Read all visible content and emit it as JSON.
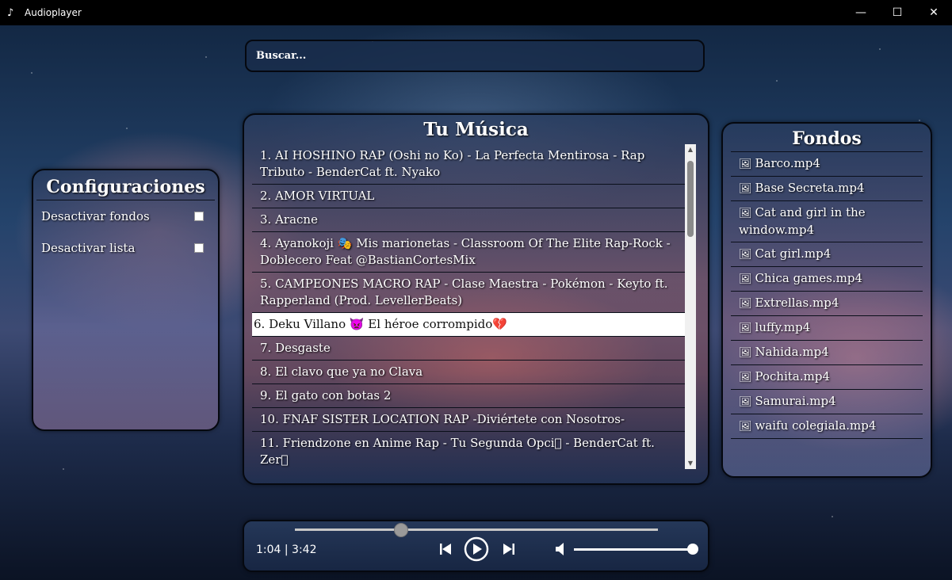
{
  "window": {
    "title": "Audioplayer",
    "minimize_icon": "—",
    "maximize_icon": "☐",
    "close_icon": "✕"
  },
  "search": {
    "placeholder": "Buscar..."
  },
  "config": {
    "title": "Configuraciones",
    "options": [
      {
        "label": "Desactivar fondos",
        "checked": false
      },
      {
        "label": "Desactivar lista",
        "checked": false
      }
    ]
  },
  "music": {
    "title": "Tu Música",
    "selected_index": 5,
    "songs": [
      "1. AI HOSHINO RAP (Oshi no Ko) - La Perfecta Mentirosa - Rap Tributo - BenderCat ft. Nyako",
      "2. AMOR VIRTUAL",
      "3. Aracne",
      "4. Ayanokoji 🎭 Mis marionetas - Classroom Of The Elite Rap-Rock - Doblecero Feat @BastianCortesMix",
      "5. CAMPEONES MACRO RAP - Clase Maestra - Pokémon - Keyto ft. Rapperland (Prod. LevellerBeats)",
      "6. Deku Villano 👿 El héroe corrompido💔",
      "7. Desgaste",
      "8. El clavo que ya no Clava",
      "9. El gato con botas 2",
      "10. FNAF SISTER LOCATION RAP -Diviértete con Nosotros-",
      "11. Friendzone en Anime Rap - Tu Segunda Opci\u0000 - BenderCat ft. Zer\u0000"
    ]
  },
  "fondos": {
    "title": "Fondos",
    "items": [
      "Barco.mp4",
      "Base Secreta.mp4",
      "Cat and girl in the window.mp4",
      "Cat girl.mp4",
      "Chica games.mp4",
      "Extrellas.mp4",
      "luffy.mp4",
      "Nahida.mp4",
      "Pochita.mp4",
      "Samurai.mp4",
      "waifu colegiala.mp4"
    ]
  },
  "player": {
    "time": "1:04 | 3:42",
    "progress": 0.29,
    "volume": 1.0
  }
}
